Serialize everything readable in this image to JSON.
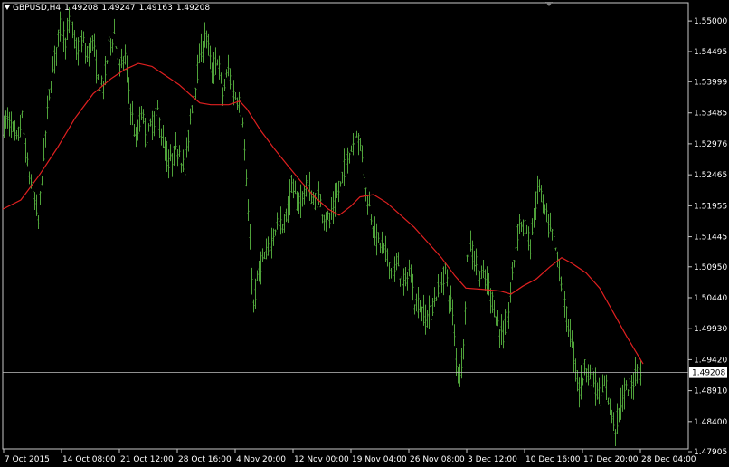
{
  "header": {
    "symbol_tf": "GBPUSD,H4",
    "open": "1.49208",
    "high": "1.49247",
    "low": "1.49163",
    "close": "1.49208"
  },
  "colors": {
    "background": "#000000",
    "bullish_bars": "#4fa23a",
    "moving_average": "#e02020",
    "axis": "#c8c8c8",
    "price_line": "#c0c0c0",
    "price_label_bg": "#ffffff"
  },
  "chart_data": {
    "type": "ohlc",
    "symbol": "GBPUSD",
    "timeframe": "H4",
    "ylim": [
      1.4795,
      1.553
    ],
    "y_ticks": [
      "1.55000",
      "1.54495",
      "1.53999",
      "1.53485",
      "1.52976",
      "1.52465",
      "1.51955",
      "1.51445",
      "1.50950",
      "1.50440",
      "1.49930",
      "1.49420",
      "1.48910",
      "1.48400",
      "1.47905"
    ],
    "x_ticks": [
      "7 Oct 2015",
      "14 Oct 08:00",
      "21 Oct 12:00",
      "28 Oct 16:00",
      "4 Nov 20:00",
      "12 Nov 00:00",
      "19 Nov 04:00",
      "26 Nov 08:00",
      "3 Dec 12:00",
      "10 Dec 16:00",
      "17 Dec 20:00",
      "28 Dec 04:00"
    ],
    "current_price": "1.49208",
    "price_anchors": [
      [
        0,
        1.527
      ],
      [
        5,
        1.534
      ],
      [
        12,
        1.533
      ],
      [
        18,
        1.53
      ],
      [
        24,
        1.534
      ],
      [
        30,
        1.526
      ],
      [
        36,
        1.522
      ],
      [
        42,
        1.517
      ],
      [
        48,
        1.528
      ],
      [
        54,
        1.538
      ],
      [
        60,
        1.544
      ],
      [
        66,
        1.549
      ],
      [
        72,
        1.547
      ],
      [
        78,
        1.55
      ],
      [
        84,
        1.545
      ],
      [
        90,
        1.547
      ],
      [
        96,
        1.544
      ],
      [
        102,
        1.547
      ],
      [
        108,
        1.54
      ],
      [
        114,
        1.539
      ],
      [
        120,
        1.546
      ],
      [
        126,
        1.548
      ],
      [
        132,
        1.542
      ],
      [
        138,
        1.544
      ],
      [
        144,
        1.536
      ],
      [
        150,
        1.53
      ],
      [
        156,
        1.535
      ],
      [
        162,
        1.531
      ],
      [
        168,
        1.533
      ],
      [
        174,
        1.535
      ],
      [
        180,
        1.53
      ],
      [
        186,
        1.526
      ],
      [
        192,
        1.528
      ],
      [
        198,
        1.529
      ],
      [
        204,
        1.525
      ],
      [
        210,
        1.534
      ],
      [
        216,
        1.54
      ],
      [
        222,
        1.545
      ],
      [
        228,
        1.548
      ],
      [
        234,
        1.541
      ],
      [
        240,
        1.544
      ],
      [
        246,
        1.538
      ],
      [
        252,
        1.542
      ],
      [
        258,
        1.538
      ],
      [
        264,
        1.537
      ],
      [
        268,
        1.534
      ],
      [
        272,
        1.523
      ],
      [
        276,
        1.513
      ],
      [
        280,
        1.503
      ],
      [
        284,
        1.507
      ],
      [
        288,
        1.51
      ],
      [
        294,
        1.511
      ],
      [
        300,
        1.514
      ],
      [
        306,
        1.517
      ],
      [
        312,
        1.516
      ],
      [
        318,
        1.519
      ],
      [
        322,
        1.523
      ],
      [
        328,
        1.52
      ],
      [
        334,
        1.521
      ],
      [
        340,
        1.523
      ],
      [
        346,
        1.52
      ],
      [
        352,
        1.521
      ],
      [
        358,
        1.518
      ],
      [
        364,
        1.517
      ],
      [
        370,
        1.52
      ],
      [
        376,
        1.523
      ],
      [
        382,
        1.527
      ],
      [
        388,
        1.529
      ],
      [
        394,
        1.532
      ],
      [
        400,
        1.528
      ],
      [
        404,
        1.522
      ],
      [
        410,
        1.518
      ],
      [
        416,
        1.514
      ],
      [
        422,
        1.513
      ],
      [
        428,
        1.511
      ],
      [
        434,
        1.508
      ],
      [
        440,
        1.51
      ],
      [
        446,
        1.506
      ],
      [
        452,
        1.509
      ],
      [
        458,
        1.504
      ],
      [
        464,
        1.503
      ],
      [
        470,
        1.501
      ],
      [
        476,
        1.502
      ],
      [
        482,
        1.505
      ],
      [
        488,
        1.507
      ],
      [
        492,
        1.509
      ],
      [
        496,
        1.505
      ],
      [
        500,
        1.502
      ],
      [
        504,
        1.494
      ],
      [
        508,
        1.492
      ],
      [
        512,
        1.496
      ],
      [
        516,
        1.511
      ],
      [
        520,
        1.513
      ],
      [
        526,
        1.51
      ],
      [
        532,
        1.508
      ],
      [
        538,
        1.507
      ],
      [
        544,
        1.504
      ],
      [
        550,
        1.5
      ],
      [
        556,
        1.498
      ],
      [
        562,
        1.502
      ],
      [
        568,
        1.511
      ],
      [
        574,
        1.517
      ],
      [
        580,
        1.516
      ],
      [
        586,
        1.513
      ],
      [
        592,
        1.52
      ],
      [
        596,
        1.523
      ],
      [
        600,
        1.52
      ],
      [
        606,
        1.516
      ],
      [
        612,
        1.514
      ],
      [
        618,
        1.509
      ],
      [
        624,
        1.503
      ],
      [
        628,
        1.5
      ],
      [
        634,
        1.495
      ],
      [
        640,
        1.489
      ],
      [
        646,
        1.493
      ],
      [
        652,
        1.492
      ],
      [
        658,
        1.49
      ],
      [
        664,
        1.488
      ],
      [
        670,
        1.49
      ],
      [
        676,
        1.485
      ],
      [
        680,
        1.483
      ],
      [
        686,
        1.487
      ],
      [
        692,
        1.489
      ],
      [
        698,
        1.49
      ],
      [
        704,
        1.4925
      ],
      [
        708,
        1.49208
      ]
    ],
    "ma_anchors": [
      [
        0,
        1.519
      ],
      [
        20,
        1.5205
      ],
      [
        40,
        1.5245
      ],
      [
        60,
        1.529
      ],
      [
        80,
        1.534
      ],
      [
        100,
        1.538
      ],
      [
        120,
        1.5405
      ],
      [
        135,
        1.542
      ],
      [
        150,
        1.543
      ],
      [
        165,
        1.5425
      ],
      [
        180,
        1.541
      ],
      [
        195,
        1.5395
      ],
      [
        210,
        1.5375
      ],
      [
        218,
        1.5365
      ],
      [
        230,
        1.5362
      ],
      [
        250,
        1.5362
      ],
      [
        262,
        1.5368
      ],
      [
        270,
        1.5355
      ],
      [
        285,
        1.532
      ],
      [
        300,
        1.529
      ],
      [
        315,
        1.5262
      ],
      [
        330,
        1.5235
      ],
      [
        345,
        1.521
      ],
      [
        360,
        1.519
      ],
      [
        372,
        1.518
      ],
      [
        385,
        1.5195
      ],
      [
        395,
        1.521
      ],
      [
        410,
        1.5214
      ],
      [
        425,
        1.52
      ],
      [
        440,
        1.518
      ],
      [
        455,
        1.516
      ],
      [
        470,
        1.5135
      ],
      [
        485,
        1.511
      ],
      [
        500,
        1.508
      ],
      [
        512,
        1.506
      ],
      [
        530,
        1.5058
      ],
      [
        550,
        1.5055
      ],
      [
        562,
        1.505
      ],
      [
        575,
        1.5063
      ],
      [
        590,
        1.5075
      ],
      [
        605,
        1.5095
      ],
      [
        618,
        1.511
      ],
      [
        630,
        1.51
      ],
      [
        645,
        1.5085
      ],
      [
        660,
        1.506
      ],
      [
        675,
        1.502
      ],
      [
        690,
        1.498
      ],
      [
        700,
        1.4955
      ],
      [
        708,
        1.4935
      ]
    ]
  }
}
